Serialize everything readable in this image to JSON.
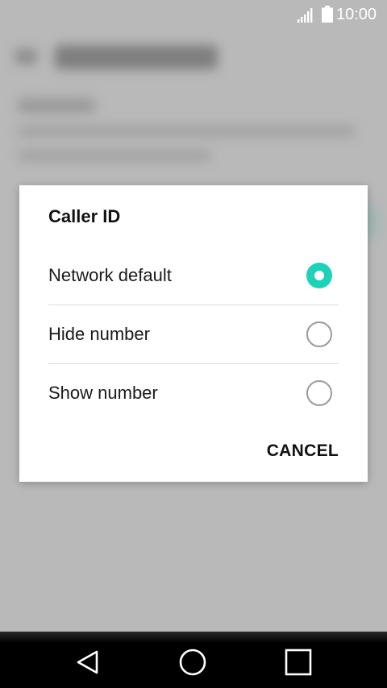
{
  "status_bar": {
    "time": "10:00",
    "icons": [
      "signal-icon",
      "battery-icon"
    ],
    "text_color": "#ffffff"
  },
  "dialog": {
    "title": "Caller ID",
    "options": [
      {
        "label": "Network default",
        "selected": true
      },
      {
        "label": "Hide number",
        "selected": false
      },
      {
        "label": "Show number",
        "selected": false
      }
    ],
    "cancel_label": "CANCEL",
    "accent_color": "#1fd1b7"
  },
  "nav_bar": {
    "icons": [
      "back-icon",
      "home-icon",
      "recent-apps-icon"
    ]
  }
}
